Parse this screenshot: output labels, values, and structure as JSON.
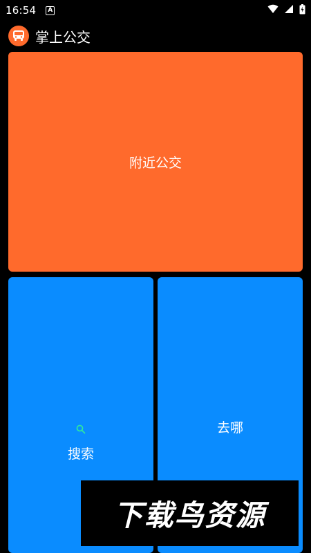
{
  "status_bar": {
    "time": "16:54",
    "notification_badge": "A"
  },
  "app_bar": {
    "title": "掌上公交",
    "logo_icon": "bus-icon"
  },
  "tiles": {
    "nearby": {
      "label": "附近公交",
      "color": "#ff6a2c"
    },
    "search": {
      "label": "搜索",
      "icon": "search-icon",
      "icon_color": "#2ee6a0",
      "color": "#0a8cff"
    },
    "where": {
      "label": "去哪",
      "color": "#0a8cff"
    }
  },
  "watermark": {
    "text": "下载鸟资源"
  }
}
